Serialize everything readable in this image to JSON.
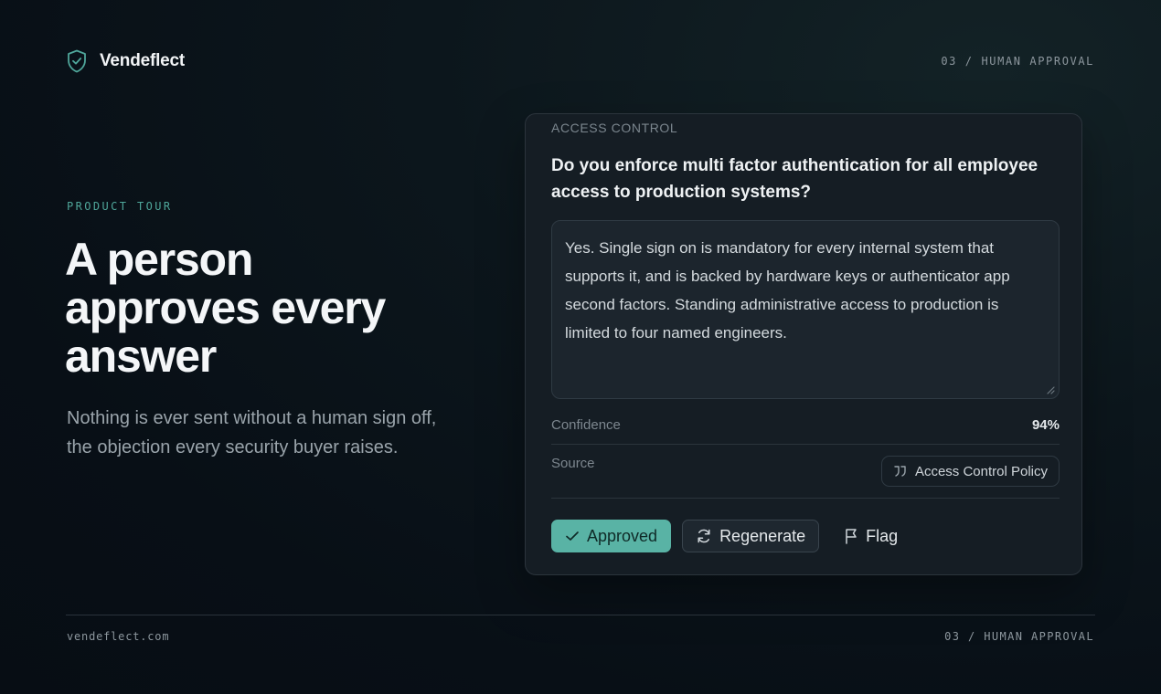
{
  "brand": {
    "name": "Vendeflect",
    "logo_icon": "shield-check-icon",
    "accent": "#4fa69a"
  },
  "header": {
    "step": "03 / HUMAN APPROVAL"
  },
  "hero": {
    "eyebrow": "PRODUCT TOUR",
    "headline": "A person approves every answer",
    "subtext": "Nothing is ever sent without a human sign off, the objection every security buyer raises."
  },
  "card": {
    "category": "ACCESS CONTROL",
    "question": "Do you enforce multi factor authentication for all employee access to production systems?",
    "answer": "Yes. Single sign on is mandatory for every internal system that supports it, and is backed by hardware keys or authenticator app second factors. Standing administrative access to production is limited to four named engineers.",
    "confidence_label": "Confidence",
    "confidence_value": "94%",
    "source_label": "Source",
    "source_value": "Access Control Policy",
    "source_icon": "quote-icon",
    "actions": {
      "approved": "Approved",
      "regenerate": "Regenerate",
      "flag": "Flag"
    },
    "colors": {
      "approved_bg": "#59b3a5"
    }
  },
  "footer": {
    "url": "vendeflect.com",
    "step": "03 / HUMAN APPROVAL"
  }
}
